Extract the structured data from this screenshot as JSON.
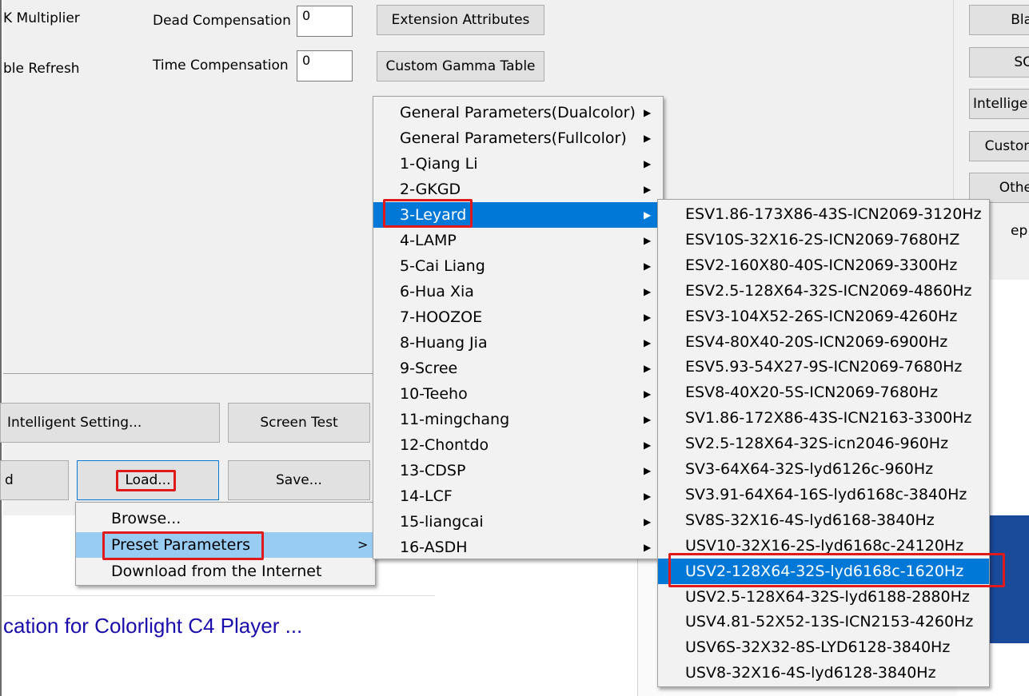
{
  "form": {
    "x_multiplier_label": "K Multiplier",
    "refresh_label": "ble Refresh",
    "dead_comp_label": "Dead Compensation",
    "dead_comp_value": "0",
    "time_comp_label": "Time Compensation",
    "time_comp_value": "0",
    "extension_btn": "Extension Attributes",
    "gamma_btn": "Custom Gamma Table"
  },
  "right_buttons": [
    "Bla",
    "SC",
    "Intellige",
    "Custon",
    "Othe",
    "ep"
  ],
  "bottom_buttons": {
    "intelligent": "Intelligent Setting...",
    "screen_test": "Screen Test",
    "read": "d",
    "load": "Load...",
    "save": "Save..."
  },
  "load_menu": [
    {
      "label": "Browse...",
      "submenu": false
    },
    {
      "label": "Preset Parameters",
      "submenu": true,
      "arrow": ">"
    },
    {
      "label": "Download from the Internet",
      "submenu": false
    }
  ],
  "preset_menu": [
    "General Parameters(Dualcolor)",
    "General Parameters(Fullcolor)",
    "1-Qiang Li",
    "2-GKGD",
    "3-Leyard",
    "4-LAMP",
    "5-Cai Liang",
    "6-Hua Xia",
    "7-HOOZOE",
    "8-Huang Jia",
    "9-Scree",
    "10-Teeho",
    "11-mingchang",
    "12-Chontdo",
    "13-CDSP",
    "14-LCF",
    "15-liangcai",
    "16-ASDH"
  ],
  "leyard_menu": [
    "ESV1.86-173X86-43S-ICN2069-3120Hz",
    "ESV10S-32X16-2S-ICN2069-7680HZ",
    "ESV2-160X80-40S-ICN2069-3300Hz",
    "ESV2.5-128X64-32S-ICN2069-4860Hz",
    "ESV3-104X52-26S-ICN2069-4260Hz",
    "ESV4-80X40-20S-ICN2069-6900Hz",
    "ESV5.93-54X27-9S-ICN2069-7680Hz",
    "ESV8-40X20-5S-ICN2069-7680Hz",
    "SV1.86-172X86-43S-ICN2163-3300Hz",
    "SV2.5-128X64-32S-icn2046-960Hz",
    "SV3-64X64-32S-lyd6126c-960Hz",
    "SV3.91-64X64-16S-lyd6168c-3840Hz",
    "SV8S-32X16-4S-lyd6168-3840Hz",
    "USV10-32X16-2S-lyd6168c-24120Hz",
    "USV2-128X64-32S-lyd6168c-1620Hz",
    "USV2.5-128X64-32S-lyd6188-2880Hz",
    "USV4.81-52X52-13S-ICN2153-4260Hz",
    "USV6S-32X32-8S-LYD6128-3840Hz",
    "USV8-32X16-4S-lyd6128-3840Hz"
  ],
  "submenu_arrow": "▶",
  "background_link": "cation for Colorlight C4 Player ...",
  "colors": {
    "highlight": "#0078d7",
    "highlight_light": "#99ccf3",
    "annotation_red": "#e01a1a",
    "link": "#1a0dab"
  }
}
